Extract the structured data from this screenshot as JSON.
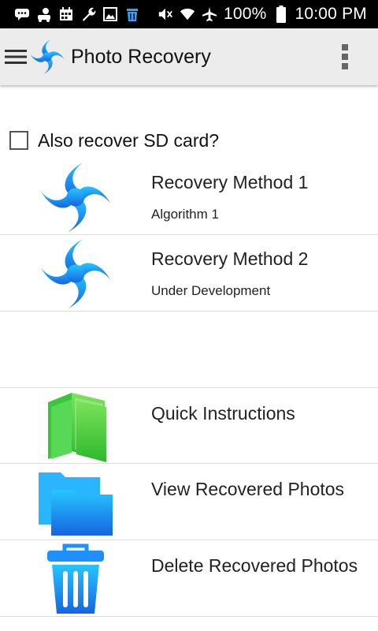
{
  "status_bar": {
    "battery_percent": "100%",
    "time": "10:00 PM",
    "left_icons": [
      "chat-icon",
      "baby-icon",
      "calendar-icon",
      "wrench-icon",
      "image-icon",
      "trash-icon"
    ],
    "right_icons": [
      "mute-icon",
      "wifi-icon",
      "airplane-icon",
      "battery-icon"
    ]
  },
  "app_bar": {
    "title": "Photo Recovery",
    "menu_icon": "hamburger-icon",
    "logo_icon": "swirl-logo-icon",
    "overflow_icon": "more-vert-icon"
  },
  "sd_option": {
    "label": "Also recover SD card?",
    "checked": false
  },
  "methods": [
    {
      "title": "Recovery Method 1",
      "subtitle": "Algorithm 1",
      "icon": "swirl-icon"
    },
    {
      "title": "Recovery Method 2",
      "subtitle": "Under Development",
      "icon": "swirl-icon"
    }
  ],
  "actions": [
    {
      "title": "Quick Instructions",
      "icon": "book-icon"
    },
    {
      "title": "View Recovered Photos",
      "icon": "folder-icon"
    },
    {
      "title": "Delete Recovered Photos",
      "icon": "trash-icon"
    }
  ],
  "colors": {
    "brand_blue": "#1e88e5",
    "book_green": "#4cd137",
    "status_bar": "#000000",
    "app_bar": "#ececec"
  }
}
